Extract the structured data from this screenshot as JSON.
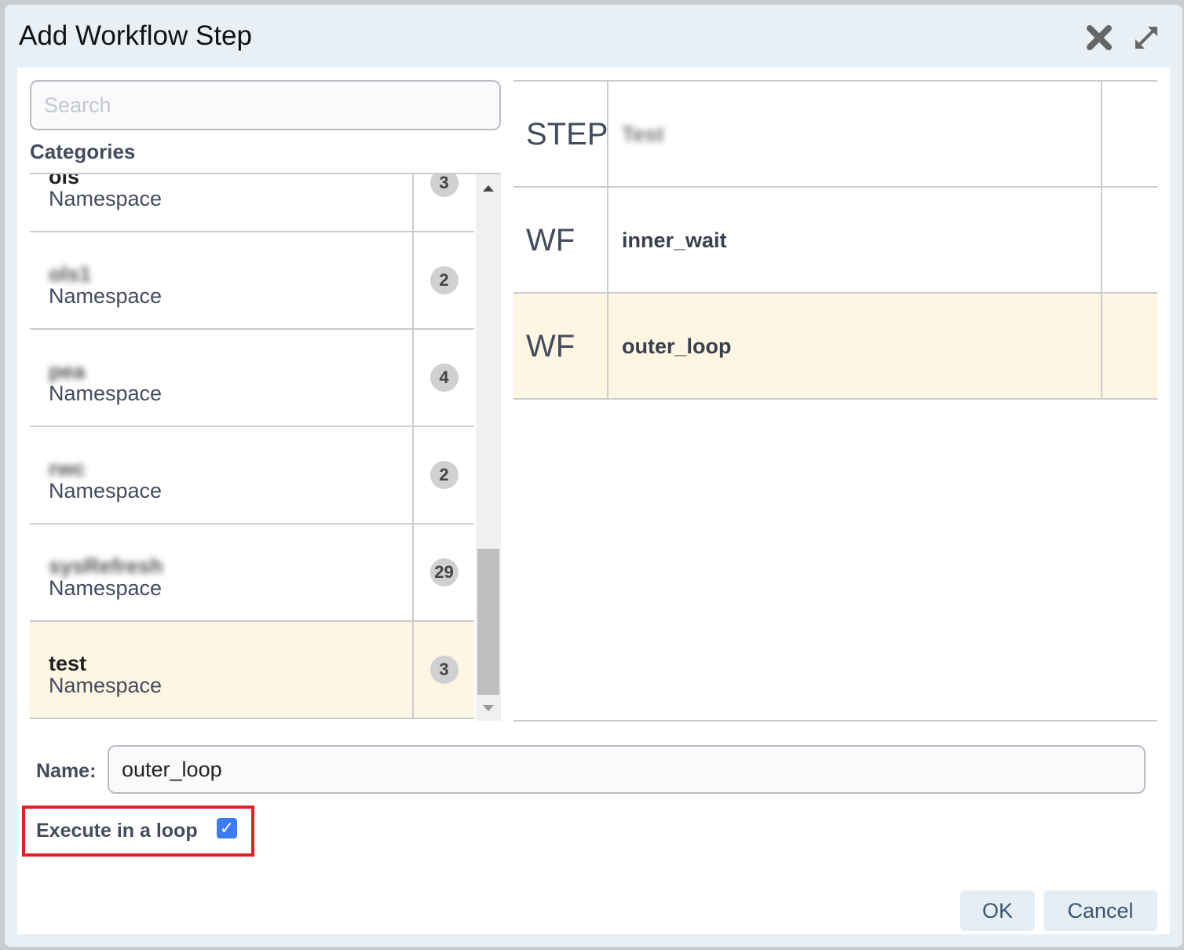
{
  "dialog": {
    "title": "Add Workflow Step",
    "close_icon": "close-icon",
    "expand_icon": "expand-icon"
  },
  "search": {
    "placeholder": "Search",
    "value": ""
  },
  "categories": {
    "label": "Categories",
    "items": [
      {
        "name": "ols",
        "type": "Namespace",
        "count": "3",
        "blurred": false,
        "selected": false
      },
      {
        "name": "ols1",
        "type": "Namespace",
        "count": "2",
        "blurred": true,
        "selected": false
      },
      {
        "name": "pea",
        "type": "Namespace",
        "count": "4",
        "blurred": true,
        "selected": false
      },
      {
        "name": "rwc",
        "type": "Namespace",
        "count": "2",
        "blurred": true,
        "selected": false
      },
      {
        "name": "sysRefresh",
        "type": "Namespace",
        "count": "29",
        "blurred": true,
        "selected": false
      },
      {
        "name": "test",
        "type": "Namespace",
        "count": "3",
        "blurred": false,
        "selected": true
      }
    ]
  },
  "steps": [
    {
      "type": "STEP",
      "name": "Test",
      "blurred": true,
      "selected": false
    },
    {
      "type": "WF",
      "name": "inner_wait",
      "blurred": false,
      "selected": false
    },
    {
      "type": "WF",
      "name": "outer_loop",
      "blurred": false,
      "selected": true
    }
  ],
  "form": {
    "name_label": "Name:",
    "name_value": "outer_loop",
    "loop_label": "Execute in a loop",
    "loop_checked": true
  },
  "buttons": {
    "ok": "OK",
    "cancel": "Cancel"
  },
  "colors": {
    "highlight": "#e81c25",
    "selected_row": "#fdf6e3",
    "checkbox": "#3d7bf2"
  }
}
